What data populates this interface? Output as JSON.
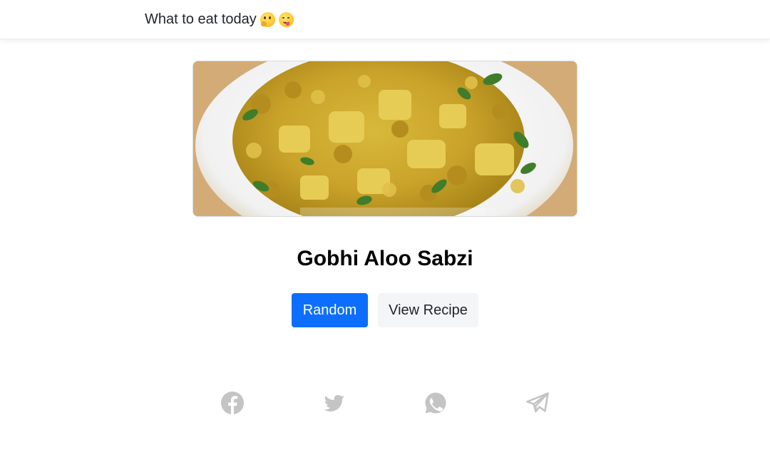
{
  "navbar": {
    "brand_text": "What to eat today",
    "emojis": [
      "thinking-face-icon",
      "face-savoring-food-icon"
    ]
  },
  "dish": {
    "name": "Gobhi Aloo Sabzi",
    "image_alt": "Gobhi Aloo Sabzi"
  },
  "actions": {
    "random_label": "Random",
    "view_recipe_label": "View Recipe"
  },
  "share": {
    "icons": [
      "facebook-icon",
      "twitter-icon",
      "whatsapp-icon",
      "telegram-icon"
    ]
  },
  "colors": {
    "primary": "#0d6efd",
    "secondary_bg": "#f4f5f6",
    "icon_gray": "#c4c4c4"
  }
}
